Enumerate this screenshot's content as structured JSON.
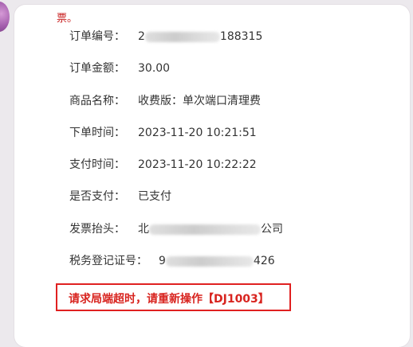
{
  "top_note": "票。",
  "order": {
    "rows": [
      {
        "label": "订单编号：",
        "value": "2",
        "value_tail": "188315"
      },
      {
        "label": "订单金额：",
        "value": "30.00"
      },
      {
        "label": "商品名称：",
        "value": "收费版：单次端口清理费"
      },
      {
        "label": "下单时间：",
        "value": "2023-11-20 10:21:51"
      },
      {
        "label": "支付时间：",
        "value": "2023-11-20 10:22:22"
      },
      {
        "label": "是否支付：",
        "value": "已支付"
      },
      {
        "label": "发票抬头：",
        "value": "北",
        "value_tail": "公司"
      },
      {
        "label": "税务登记证号：",
        "value": "9",
        "value_tail": "426"
      }
    ]
  },
  "error": {
    "message": "请求局端超时，请重新操作【DJ1003】",
    "color": "#d8241f"
  }
}
